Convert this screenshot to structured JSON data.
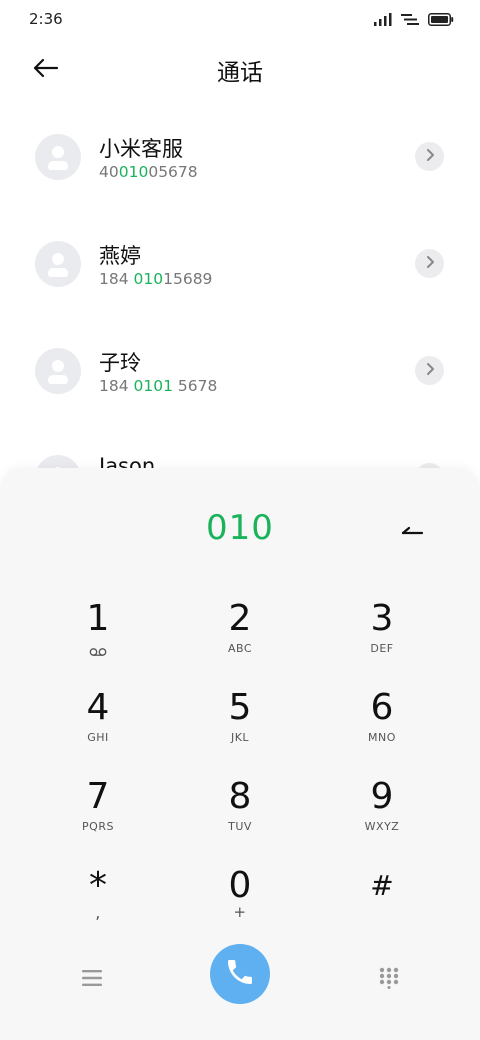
{
  "status_bar": {
    "time": "2:36"
  },
  "header": {
    "title": "通话"
  },
  "contacts": [
    {
      "name": "小米客服",
      "number_pre": "40",
      "number_match": "010",
      "number_post": "05678"
    },
    {
      "name": "燕婷",
      "number_pre": "184 ",
      "number_match": "010",
      "number_post": "15689"
    },
    {
      "name": "子玲",
      "number_pre": "184 ",
      "number_match": "0101",
      "number_post": " 5678"
    },
    {
      "name": "Jason",
      "number_pre": "",
      "number_match": "",
      "number_post": ""
    }
  ],
  "dialpad": {
    "input": "010",
    "keys": [
      {
        "digit": "1",
        "sub": ""
      },
      {
        "digit": "2",
        "sub": "ABC"
      },
      {
        "digit": "3",
        "sub": "DEF"
      },
      {
        "digit": "4",
        "sub": "GHI"
      },
      {
        "digit": "5",
        "sub": "JKL"
      },
      {
        "digit": "6",
        "sub": "MNO"
      },
      {
        "digit": "7",
        "sub": "PQRS"
      },
      {
        "digit": "8",
        "sub": "TUV"
      },
      {
        "digit": "9",
        "sub": "WXYZ"
      },
      {
        "digit": "*",
        "sub": ","
      },
      {
        "digit": "0",
        "sub": "+"
      },
      {
        "digit": "#",
        "sub": ""
      }
    ]
  },
  "icons": {
    "signal": "signal-icon",
    "wifi": "wifi-icon",
    "battery": "battery-icon",
    "back": "back-arrow-icon",
    "chevron": "chevron-right-icon",
    "backspace": "backspace-icon",
    "voicemail": "voicemail-icon",
    "menu": "menu-icon",
    "call": "phone-icon",
    "keypad": "dialpad-icon"
  },
  "colors": {
    "accent_green": "#1ab35b",
    "call_blue": "#5eb0f0",
    "dialpad_bg": "#f7f7f7",
    "avatar_bg": "#e9ebef"
  }
}
